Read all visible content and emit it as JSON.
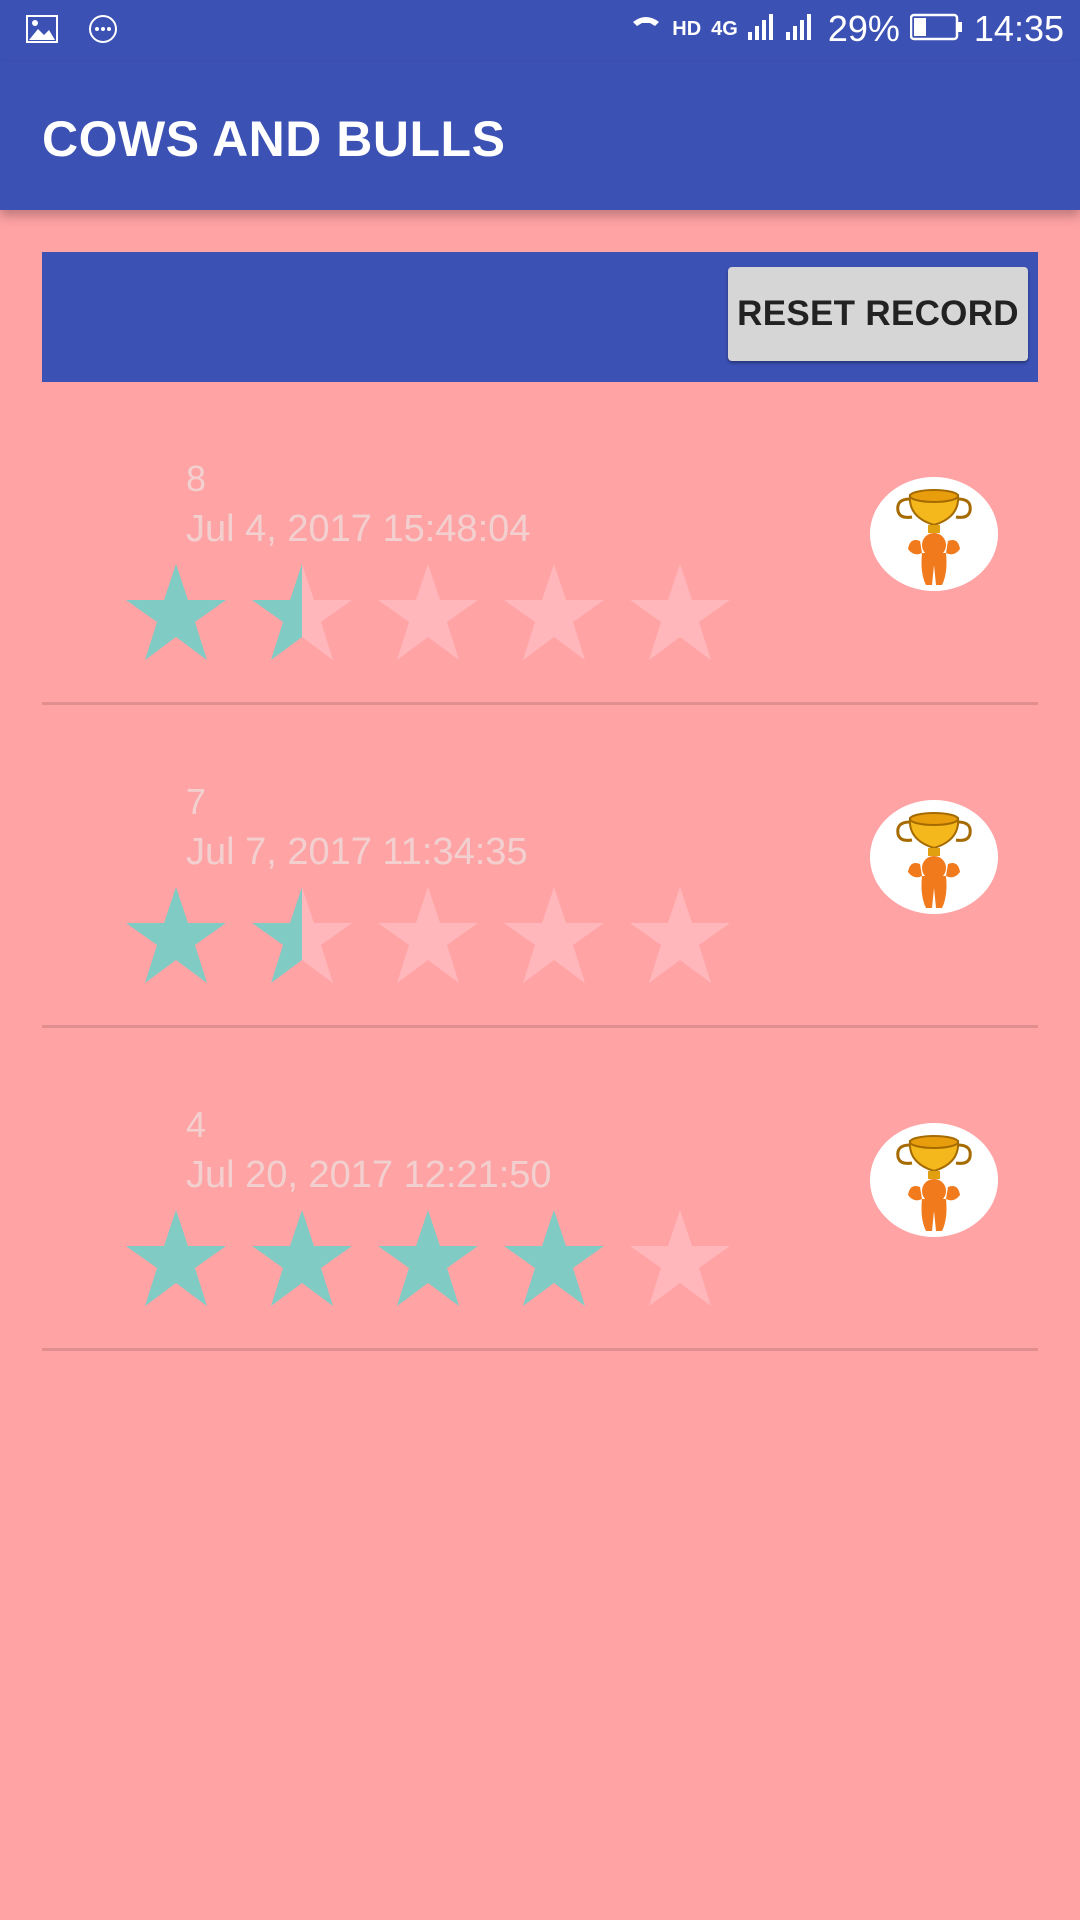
{
  "status_bar": {
    "battery": "29%",
    "time": "14:35",
    "network": "4G",
    "hd": "HD",
    "icons": [
      "image-icon",
      "more-icon",
      "call-icon",
      "signal-icon",
      "battery-icon"
    ]
  },
  "app": {
    "title": "COWS AND BULLS"
  },
  "toolbar": {
    "reset_label": "RESET RECORD"
  },
  "colors": {
    "primary": "#3b51b4",
    "background": "#ffa3a5",
    "star_filled": "#80cbc4",
    "star_empty": "#ffb7bb"
  },
  "records": [
    {
      "score": "8",
      "date": "Jul 4, 2017 15:48:04",
      "rating": 1.5,
      "max_rating": 5,
      "icon": "trophy-icon"
    },
    {
      "score": "7",
      "date": "Jul 7, 2017 11:34:35",
      "rating": 1.5,
      "max_rating": 5,
      "icon": "trophy-icon"
    },
    {
      "score": "4",
      "date": "Jul 20, 2017 12:21:50",
      "rating": 4,
      "max_rating": 5,
      "icon": "trophy-icon"
    }
  ]
}
